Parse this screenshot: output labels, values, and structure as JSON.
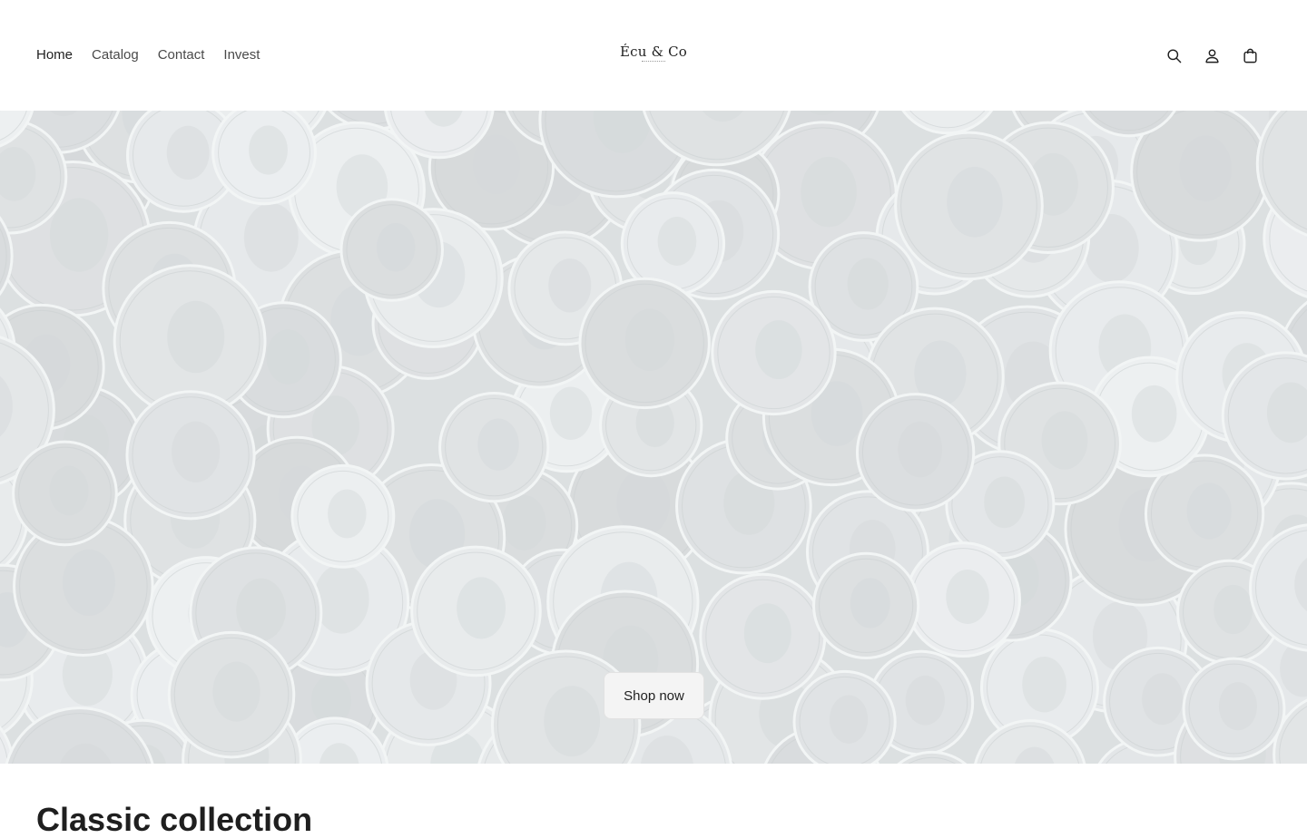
{
  "header": {
    "nav": [
      {
        "label": "Home",
        "active": true
      },
      {
        "label": "Catalog"
      },
      {
        "label": "Contact"
      },
      {
        "label": "Invest"
      }
    ],
    "logo": "Écu & Co",
    "icons": [
      "search-icon",
      "account-icon",
      "cart-icon"
    ]
  },
  "hero": {
    "button_label": "Shop now",
    "image": "pile of silver coins"
  },
  "section": {
    "title": "Classic collection"
  },
  "colors": {
    "text": "#1f1f1f",
    "nav_text": "#4a4a4a",
    "button_bg": "#f4f4f4"
  }
}
